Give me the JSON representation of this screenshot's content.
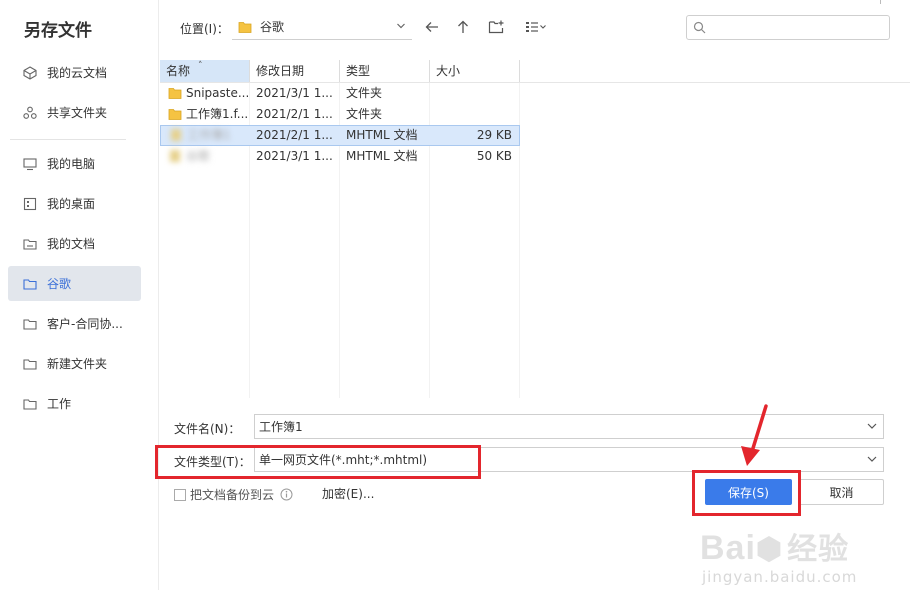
{
  "dialog": {
    "title": "另存文件"
  },
  "sidebar": {
    "items": [
      {
        "label": "我的云文档",
        "icon": "cloud-doc-icon"
      },
      {
        "label": "共享文件夹",
        "icon": "share-icon"
      },
      {
        "label": "我的电脑",
        "icon": "monitor-icon"
      },
      {
        "label": "我的桌面",
        "icon": "desktop-icon"
      },
      {
        "label": "我的文档",
        "icon": "document-folder-icon"
      },
      {
        "label": "谷歌",
        "icon": "folder-icon",
        "active": true
      },
      {
        "label": "客户-合同协...",
        "icon": "folder-icon"
      },
      {
        "label": "新建文件夹",
        "icon": "folder-icon"
      },
      {
        "label": "工作",
        "icon": "folder-icon"
      }
    ]
  },
  "toolbar": {
    "location_label": "位置(I)：",
    "location_value": "谷歌"
  },
  "file_list": {
    "columns": [
      "名称",
      "修改日期",
      "类型",
      "大小"
    ],
    "rows": [
      {
        "name": "Snipaste...",
        "date": "2021/3/1 1...",
        "type": "文件夹",
        "size": ""
      },
      {
        "name": "工作簿1.f...",
        "date": "2021/2/1 1...",
        "type": "文件夹",
        "size": ""
      },
      {
        "name": "工作簿1",
        "date": "2021/2/1 1...",
        "type": "MHTML 文档",
        "size": "29 KB",
        "selected": true
      },
      {
        "name": "谷歌",
        "date": "2021/3/1 1...",
        "type": "MHTML 文档",
        "size": "50 KB"
      }
    ]
  },
  "form": {
    "filename_label": "文件名(N)：",
    "filename_value": "工作簿1",
    "filetype_label": "文件类型(T)：",
    "filetype_value": "单一网页文件(*.mht;*.mhtml)",
    "backup_label": "把文档备份到云",
    "encrypt_label": "加密(E)...",
    "save_label": "保存(S)",
    "cancel_label": "取消"
  },
  "colors": {
    "accent": "#3a7bea",
    "annotation": "#e3262d",
    "selected_row": "#d9e8fb"
  },
  "watermark": {
    "brand": "Bai",
    "brand2": "经验",
    "url": "jingyan.baidu.com"
  }
}
